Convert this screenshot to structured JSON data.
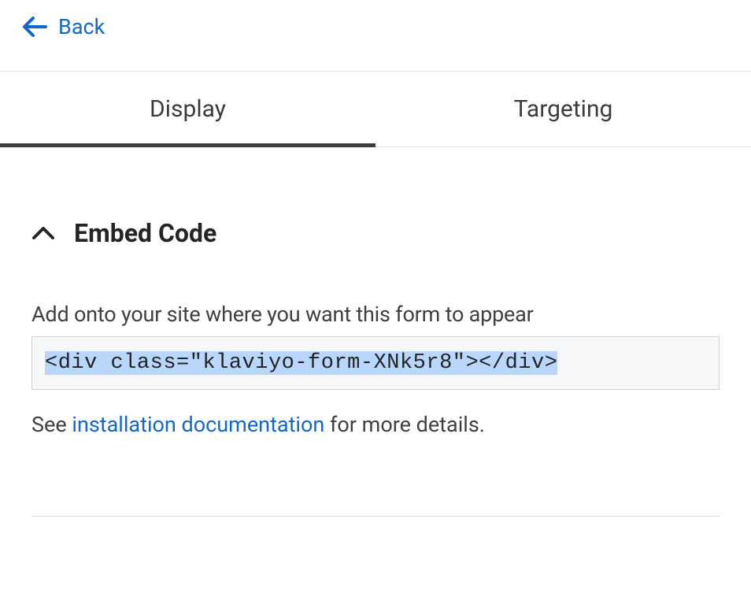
{
  "header": {
    "back_label": "Back"
  },
  "tabs": {
    "display": "Display",
    "targeting": "Targeting"
  },
  "section": {
    "title": "Embed Code",
    "instruction": "Add onto your site where you want this form to appear",
    "code": "<div class=\"klaviyo-form-XNk5r8\"></div>",
    "help_prefix": "See ",
    "help_link": "installation documentation",
    "help_suffix": " for more details."
  }
}
